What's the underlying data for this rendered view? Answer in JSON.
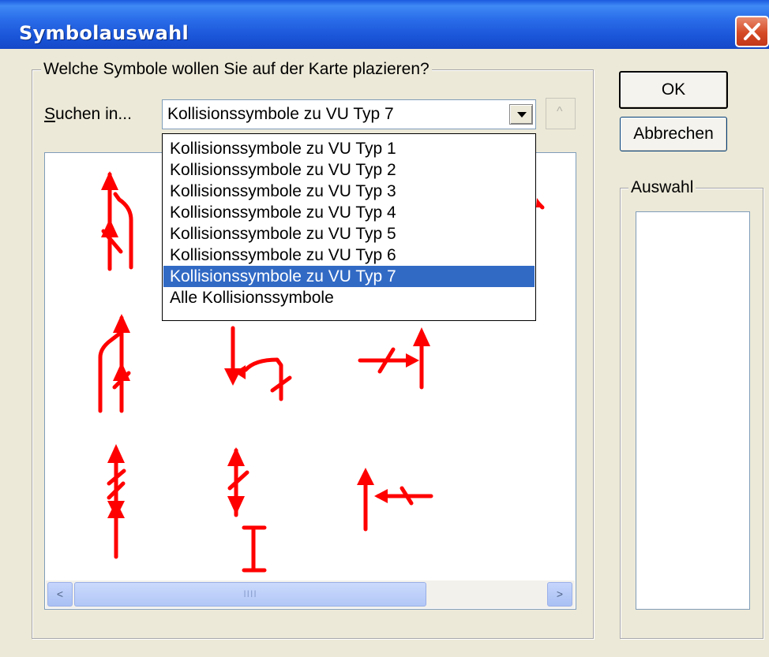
{
  "window": {
    "title": "Symbolauswahl",
    "close_icon": "close-icon"
  },
  "group_main": {
    "label": "Welche Symbole wollen Sie auf der Karte plazieren?"
  },
  "search": {
    "label_underlined": "S",
    "label_rest": "uchen in...",
    "selected": "Kollisionssymbole zu  VU Typ 7",
    "options": [
      "Kollisionssymbole zu  VU Typ 1",
      "Kollisionssymbole zu  VU Typ 2",
      "Kollisionssymbole zu  VU Typ 3",
      "Kollisionssymbole zu  VU Typ 4",
      "Kollisionssymbole zu  VU Typ 5",
      "Kollisionssymbole zu  VU Typ 6",
      "Kollisionssymbole zu  VU Typ 7",
      "Alle Kollisionssymbole"
    ],
    "selected_index": 6,
    "up_button_glyph": "^"
  },
  "buttons": {
    "ok": "OK",
    "cancel": "Abbrechen"
  },
  "group_selection": {
    "label": "Auswahl"
  },
  "scrollbar": {
    "left": "<",
    "right": ">",
    "grip": "IIII"
  },
  "colors": {
    "symbol_red": "#ff0000",
    "highlight": "#316ac5",
    "titlebar": "#2a6ce9"
  }
}
